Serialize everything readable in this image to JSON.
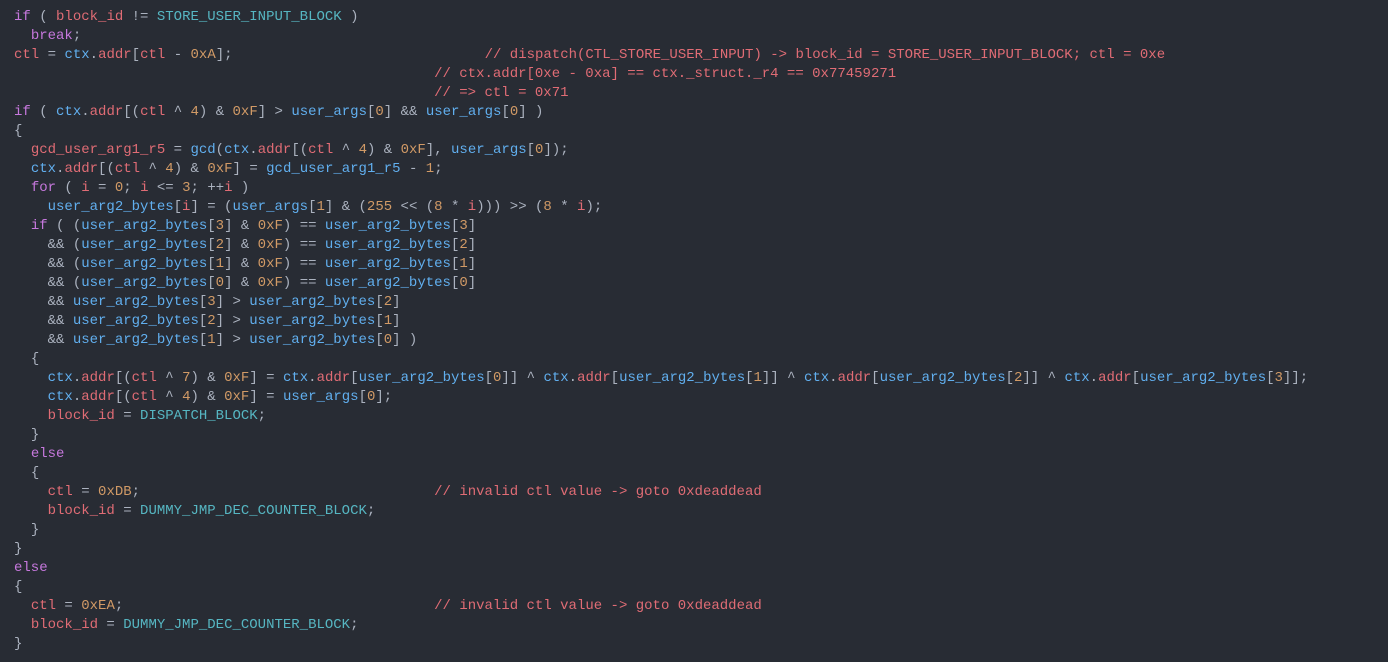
{
  "code_lines": [
    {
      "indent": 0,
      "segs": [
        {
          "c": "kw",
          "t": "if"
        },
        {
          "c": "op",
          "t": " ( "
        },
        {
          "c": "id",
          "t": "block_id"
        },
        {
          "c": "op",
          "t": " != "
        },
        {
          "c": "con",
          "t": "STORE_USER_INPUT_BLOCK"
        },
        {
          "c": "op",
          "t": " )"
        }
      ]
    },
    {
      "indent": 1,
      "segs": [
        {
          "c": "kw",
          "t": "break"
        },
        {
          "c": "op",
          "t": ";"
        }
      ]
    },
    {
      "indent": 0,
      "segs": [
        {
          "c": "id",
          "t": "ctl"
        },
        {
          "c": "op",
          "t": " = "
        },
        {
          "c": "fn",
          "t": "ctx"
        },
        {
          "c": "op",
          "t": "."
        },
        {
          "c": "id",
          "t": "addr"
        },
        {
          "c": "op",
          "t": "["
        },
        {
          "c": "id",
          "t": "ctl"
        },
        {
          "c": "op",
          "t": " - "
        },
        {
          "c": "num",
          "t": "0xA"
        },
        {
          "c": "op",
          "t": "];"
        },
        {
          "c": "op",
          "t": "                              "
        },
        {
          "c": "cm",
          "t": "// dispatch(CTL_STORE_USER_INPUT) -> block_id = STORE_USER_INPUT_BLOCK; ctl = 0xe"
        }
      ]
    },
    {
      "indent": 0,
      "segs": [
        {
          "c": "op",
          "t": "                                                  "
        },
        {
          "c": "cm",
          "t": "// ctx.addr[0xe - 0xa] == ctx._struct._r4 == 0x77459271"
        }
      ]
    },
    {
      "indent": 0,
      "segs": [
        {
          "c": "op",
          "t": "                                                  "
        },
        {
          "c": "cm",
          "t": "// => ctl = 0x71"
        }
      ]
    },
    {
      "indent": 0,
      "segs": [
        {
          "c": "kw",
          "t": "if"
        },
        {
          "c": "op",
          "t": " ( "
        },
        {
          "c": "fn",
          "t": "ctx"
        },
        {
          "c": "op",
          "t": "."
        },
        {
          "c": "id",
          "t": "addr"
        },
        {
          "c": "op",
          "t": "[("
        },
        {
          "c": "id",
          "t": "ctl"
        },
        {
          "c": "op",
          "t": " ^ "
        },
        {
          "c": "num",
          "t": "4"
        },
        {
          "c": "op",
          "t": ") & "
        },
        {
          "c": "num",
          "t": "0xF"
        },
        {
          "c": "op",
          "t": "] > "
        },
        {
          "c": "fn",
          "t": "user_args"
        },
        {
          "c": "op",
          "t": "["
        },
        {
          "c": "num",
          "t": "0"
        },
        {
          "c": "op",
          "t": "] && "
        },
        {
          "c": "fn",
          "t": "user_args"
        },
        {
          "c": "op",
          "t": "["
        },
        {
          "c": "num",
          "t": "0"
        },
        {
          "c": "op",
          "t": "] )"
        }
      ]
    },
    {
      "indent": 0,
      "segs": [
        {
          "c": "op",
          "t": "{"
        }
      ]
    },
    {
      "indent": 1,
      "segs": [
        {
          "c": "id",
          "t": "gcd_user_arg1_r5"
        },
        {
          "c": "op",
          "t": " = "
        },
        {
          "c": "fn",
          "t": "gcd"
        },
        {
          "c": "op",
          "t": "("
        },
        {
          "c": "fn",
          "t": "ctx"
        },
        {
          "c": "op",
          "t": "."
        },
        {
          "c": "id",
          "t": "addr"
        },
        {
          "c": "op",
          "t": "[("
        },
        {
          "c": "id",
          "t": "ctl"
        },
        {
          "c": "op",
          "t": " ^ "
        },
        {
          "c": "num",
          "t": "4"
        },
        {
          "c": "op",
          "t": ") & "
        },
        {
          "c": "num",
          "t": "0xF"
        },
        {
          "c": "op",
          "t": "], "
        },
        {
          "c": "fn",
          "t": "user_args"
        },
        {
          "c": "op",
          "t": "["
        },
        {
          "c": "num",
          "t": "0"
        },
        {
          "c": "op",
          "t": "]);"
        }
      ]
    },
    {
      "indent": 1,
      "segs": [
        {
          "c": "fn",
          "t": "ctx"
        },
        {
          "c": "op",
          "t": "."
        },
        {
          "c": "id",
          "t": "addr"
        },
        {
          "c": "op",
          "t": "[("
        },
        {
          "c": "id",
          "t": "ctl"
        },
        {
          "c": "op",
          "t": " ^ "
        },
        {
          "c": "num",
          "t": "4"
        },
        {
          "c": "op",
          "t": ") & "
        },
        {
          "c": "num",
          "t": "0xF"
        },
        {
          "c": "op",
          "t": "] = "
        },
        {
          "c": "fn",
          "t": "gcd_user_arg1_r5"
        },
        {
          "c": "op",
          "t": " - "
        },
        {
          "c": "num",
          "t": "1"
        },
        {
          "c": "op",
          "t": ";"
        }
      ]
    },
    {
      "indent": 1,
      "segs": [
        {
          "c": "kw",
          "t": "for"
        },
        {
          "c": "op",
          "t": " ( "
        },
        {
          "c": "id",
          "t": "i"
        },
        {
          "c": "op",
          "t": " = "
        },
        {
          "c": "num",
          "t": "0"
        },
        {
          "c": "op",
          "t": "; "
        },
        {
          "c": "id",
          "t": "i"
        },
        {
          "c": "op",
          "t": " <= "
        },
        {
          "c": "num",
          "t": "3"
        },
        {
          "c": "op",
          "t": "; ++"
        },
        {
          "c": "id",
          "t": "i"
        },
        {
          "c": "op",
          "t": " )"
        }
      ]
    },
    {
      "indent": 2,
      "segs": [
        {
          "c": "fn",
          "t": "user_arg2_bytes"
        },
        {
          "c": "op",
          "t": "["
        },
        {
          "c": "id",
          "t": "i"
        },
        {
          "c": "op",
          "t": "] = ("
        },
        {
          "c": "fn",
          "t": "user_args"
        },
        {
          "c": "op",
          "t": "["
        },
        {
          "c": "num",
          "t": "1"
        },
        {
          "c": "op",
          "t": "] & ("
        },
        {
          "c": "num",
          "t": "255"
        },
        {
          "c": "op",
          "t": " << ("
        },
        {
          "c": "num",
          "t": "8"
        },
        {
          "c": "op",
          "t": " * "
        },
        {
          "c": "id",
          "t": "i"
        },
        {
          "c": "op",
          "t": "))) >> ("
        },
        {
          "c": "num",
          "t": "8"
        },
        {
          "c": "op",
          "t": " * "
        },
        {
          "c": "id",
          "t": "i"
        },
        {
          "c": "op",
          "t": ");"
        }
      ]
    },
    {
      "indent": 1,
      "segs": [
        {
          "c": "kw",
          "t": "if"
        },
        {
          "c": "op",
          "t": " ( ("
        },
        {
          "c": "fn",
          "t": "user_arg2_bytes"
        },
        {
          "c": "op",
          "t": "["
        },
        {
          "c": "num",
          "t": "3"
        },
        {
          "c": "op",
          "t": "] & "
        },
        {
          "c": "num",
          "t": "0xF"
        },
        {
          "c": "op",
          "t": ") == "
        },
        {
          "c": "fn",
          "t": "user_arg2_bytes"
        },
        {
          "c": "op",
          "t": "["
        },
        {
          "c": "num",
          "t": "3"
        },
        {
          "c": "op",
          "t": "]"
        }
      ]
    },
    {
      "indent": 2,
      "segs": [
        {
          "c": "op",
          "t": "&& ("
        },
        {
          "c": "fn",
          "t": "user_arg2_bytes"
        },
        {
          "c": "op",
          "t": "["
        },
        {
          "c": "num",
          "t": "2"
        },
        {
          "c": "op",
          "t": "] & "
        },
        {
          "c": "num",
          "t": "0xF"
        },
        {
          "c": "op",
          "t": ") == "
        },
        {
          "c": "fn",
          "t": "user_arg2_bytes"
        },
        {
          "c": "op",
          "t": "["
        },
        {
          "c": "num",
          "t": "2"
        },
        {
          "c": "op",
          "t": "]"
        }
      ]
    },
    {
      "indent": 2,
      "segs": [
        {
          "c": "op",
          "t": "&& ("
        },
        {
          "c": "fn",
          "t": "user_arg2_bytes"
        },
        {
          "c": "op",
          "t": "["
        },
        {
          "c": "num",
          "t": "1"
        },
        {
          "c": "op",
          "t": "] & "
        },
        {
          "c": "num",
          "t": "0xF"
        },
        {
          "c": "op",
          "t": ") == "
        },
        {
          "c": "fn",
          "t": "user_arg2_bytes"
        },
        {
          "c": "op",
          "t": "["
        },
        {
          "c": "num",
          "t": "1"
        },
        {
          "c": "op",
          "t": "]"
        }
      ]
    },
    {
      "indent": 2,
      "segs": [
        {
          "c": "op",
          "t": "&& ("
        },
        {
          "c": "fn",
          "t": "user_arg2_bytes"
        },
        {
          "c": "op",
          "t": "["
        },
        {
          "c": "num",
          "t": "0"
        },
        {
          "c": "op",
          "t": "] & "
        },
        {
          "c": "num",
          "t": "0xF"
        },
        {
          "c": "op",
          "t": ") == "
        },
        {
          "c": "fn",
          "t": "user_arg2_bytes"
        },
        {
          "c": "op",
          "t": "["
        },
        {
          "c": "num",
          "t": "0"
        },
        {
          "c": "op",
          "t": "]"
        }
      ]
    },
    {
      "indent": 2,
      "segs": [
        {
          "c": "op",
          "t": "&& "
        },
        {
          "c": "fn",
          "t": "user_arg2_bytes"
        },
        {
          "c": "op",
          "t": "["
        },
        {
          "c": "num",
          "t": "3"
        },
        {
          "c": "op",
          "t": "] > "
        },
        {
          "c": "fn",
          "t": "user_arg2_bytes"
        },
        {
          "c": "op",
          "t": "["
        },
        {
          "c": "num",
          "t": "2"
        },
        {
          "c": "op",
          "t": "]"
        }
      ]
    },
    {
      "indent": 2,
      "segs": [
        {
          "c": "op",
          "t": "&& "
        },
        {
          "c": "fn",
          "t": "user_arg2_bytes"
        },
        {
          "c": "op",
          "t": "["
        },
        {
          "c": "num",
          "t": "2"
        },
        {
          "c": "op",
          "t": "] > "
        },
        {
          "c": "fn",
          "t": "user_arg2_bytes"
        },
        {
          "c": "op",
          "t": "["
        },
        {
          "c": "num",
          "t": "1"
        },
        {
          "c": "op",
          "t": "]"
        }
      ]
    },
    {
      "indent": 2,
      "segs": [
        {
          "c": "op",
          "t": "&& "
        },
        {
          "c": "fn",
          "t": "user_arg2_bytes"
        },
        {
          "c": "op",
          "t": "["
        },
        {
          "c": "num",
          "t": "1"
        },
        {
          "c": "op",
          "t": "] > "
        },
        {
          "c": "fn",
          "t": "user_arg2_bytes"
        },
        {
          "c": "op",
          "t": "["
        },
        {
          "c": "num",
          "t": "0"
        },
        {
          "c": "op",
          "t": "] )"
        }
      ]
    },
    {
      "indent": 1,
      "segs": [
        {
          "c": "op",
          "t": "{"
        }
      ]
    },
    {
      "indent": 2,
      "segs": [
        {
          "c": "fn",
          "t": "ctx"
        },
        {
          "c": "op",
          "t": "."
        },
        {
          "c": "id",
          "t": "addr"
        },
        {
          "c": "op",
          "t": "[("
        },
        {
          "c": "id",
          "t": "ctl"
        },
        {
          "c": "op",
          "t": " ^ "
        },
        {
          "c": "num",
          "t": "7"
        },
        {
          "c": "op",
          "t": ") & "
        },
        {
          "c": "num",
          "t": "0xF"
        },
        {
          "c": "op",
          "t": "] = "
        },
        {
          "c": "fn",
          "t": "ctx"
        },
        {
          "c": "op",
          "t": "."
        },
        {
          "c": "id",
          "t": "addr"
        },
        {
          "c": "op",
          "t": "["
        },
        {
          "c": "fn",
          "t": "user_arg2_bytes"
        },
        {
          "c": "op",
          "t": "["
        },
        {
          "c": "num",
          "t": "0"
        },
        {
          "c": "op",
          "t": "]] ^ "
        },
        {
          "c": "fn",
          "t": "ctx"
        },
        {
          "c": "op",
          "t": "."
        },
        {
          "c": "id",
          "t": "addr"
        },
        {
          "c": "op",
          "t": "["
        },
        {
          "c": "fn",
          "t": "user_arg2_bytes"
        },
        {
          "c": "op",
          "t": "["
        },
        {
          "c": "num",
          "t": "1"
        },
        {
          "c": "op",
          "t": "]] ^ "
        },
        {
          "c": "fn",
          "t": "ctx"
        },
        {
          "c": "op",
          "t": "."
        },
        {
          "c": "id",
          "t": "addr"
        },
        {
          "c": "op",
          "t": "["
        },
        {
          "c": "fn",
          "t": "user_arg2_bytes"
        },
        {
          "c": "op",
          "t": "["
        },
        {
          "c": "num",
          "t": "2"
        },
        {
          "c": "op",
          "t": "]] ^ "
        },
        {
          "c": "fn",
          "t": "ctx"
        },
        {
          "c": "op",
          "t": "."
        },
        {
          "c": "id",
          "t": "addr"
        },
        {
          "c": "op",
          "t": "["
        },
        {
          "c": "fn",
          "t": "user_arg2_bytes"
        },
        {
          "c": "op",
          "t": "["
        },
        {
          "c": "num",
          "t": "3"
        },
        {
          "c": "op",
          "t": "]];"
        }
      ]
    },
    {
      "indent": 2,
      "segs": [
        {
          "c": "fn",
          "t": "ctx"
        },
        {
          "c": "op",
          "t": "."
        },
        {
          "c": "id",
          "t": "addr"
        },
        {
          "c": "op",
          "t": "[("
        },
        {
          "c": "id",
          "t": "ctl"
        },
        {
          "c": "op",
          "t": " ^ "
        },
        {
          "c": "num",
          "t": "4"
        },
        {
          "c": "op",
          "t": ") & "
        },
        {
          "c": "num",
          "t": "0xF"
        },
        {
          "c": "op",
          "t": "] = "
        },
        {
          "c": "fn",
          "t": "user_args"
        },
        {
          "c": "op",
          "t": "["
        },
        {
          "c": "num",
          "t": "0"
        },
        {
          "c": "op",
          "t": "];"
        }
      ]
    },
    {
      "indent": 2,
      "segs": [
        {
          "c": "id",
          "t": "block_id"
        },
        {
          "c": "op",
          "t": " = "
        },
        {
          "c": "con",
          "t": "DISPATCH_BLOCK"
        },
        {
          "c": "op",
          "t": ";"
        }
      ]
    },
    {
      "indent": 1,
      "segs": [
        {
          "c": "op",
          "t": "}"
        }
      ]
    },
    {
      "indent": 1,
      "segs": [
        {
          "c": "kw",
          "t": "else"
        }
      ]
    },
    {
      "indent": 1,
      "segs": [
        {
          "c": "op",
          "t": "{"
        }
      ]
    },
    {
      "indent": 2,
      "segs": [
        {
          "c": "id",
          "t": "ctl"
        },
        {
          "c": "op",
          "t": " = "
        },
        {
          "c": "num",
          "t": "0xDB"
        },
        {
          "c": "op",
          "t": ";                                   "
        },
        {
          "c": "cm",
          "t": "// invalid ctl value -> goto 0xdeaddead"
        }
      ]
    },
    {
      "indent": 2,
      "segs": [
        {
          "c": "id",
          "t": "block_id"
        },
        {
          "c": "op",
          "t": " = "
        },
        {
          "c": "con",
          "t": "DUMMY_JMP_DEC_COUNTER_BLOCK"
        },
        {
          "c": "op",
          "t": ";"
        }
      ]
    },
    {
      "indent": 1,
      "segs": [
        {
          "c": "op",
          "t": "}"
        }
      ]
    },
    {
      "indent": 0,
      "segs": [
        {
          "c": "op",
          "t": "}"
        }
      ]
    },
    {
      "indent": 0,
      "segs": [
        {
          "c": "kw",
          "t": "else"
        }
      ]
    },
    {
      "indent": 0,
      "segs": [
        {
          "c": "op",
          "t": "{"
        }
      ]
    },
    {
      "indent": 1,
      "segs": [
        {
          "c": "id",
          "t": "ctl"
        },
        {
          "c": "op",
          "t": " = "
        },
        {
          "c": "num",
          "t": "0xEA"
        },
        {
          "c": "op",
          "t": ";                                     "
        },
        {
          "c": "cm",
          "t": "// invalid ctl value -> goto 0xdeaddead"
        }
      ]
    },
    {
      "indent": 1,
      "segs": [
        {
          "c": "id",
          "t": "block_id"
        },
        {
          "c": "op",
          "t": " = "
        },
        {
          "c": "con",
          "t": "DUMMY_JMP_DEC_COUNTER_BLOCK"
        },
        {
          "c": "op",
          "t": ";"
        }
      ]
    },
    {
      "indent": 0,
      "segs": [
        {
          "c": "op",
          "t": "}"
        }
      ]
    }
  ]
}
